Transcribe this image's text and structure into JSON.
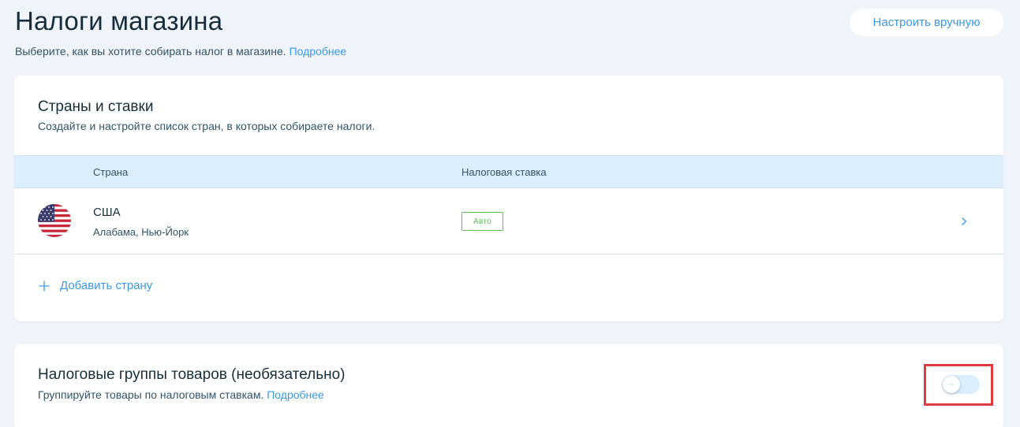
{
  "header": {
    "title": "Налоги магазина",
    "subtitle": "Выберите, как вы хотите собирать налог в магазине.",
    "learn_more": "Подробнее",
    "manual_button": "Настроить вручную"
  },
  "countries_card": {
    "title": "Страны и ставки",
    "description": "Создайте и настройте список стран, в которых собираете налоги.",
    "columns": [
      "Страна",
      "Налоговая ставка"
    ],
    "rows": [
      {
        "flag": "us-flag-icon",
        "country": "США",
        "regions": "Алабама, Нью-Йорк",
        "rate": "Авто"
      }
    ],
    "add_country": "Добавить страну"
  },
  "groups_card": {
    "title": "Налоговые группы товаров (необязательно)",
    "description": "Группируйте товары по налоговым ставкам.",
    "learn_more": "Подробнее",
    "toggle_on": false
  },
  "colors": {
    "accent": "#3899ec",
    "title": "#162d3d",
    "badge_green": "#60bc57",
    "table_header_bg": "#dbeefd",
    "highlight_red": "#e0393e",
    "page_bg": "#f0f3f8"
  }
}
